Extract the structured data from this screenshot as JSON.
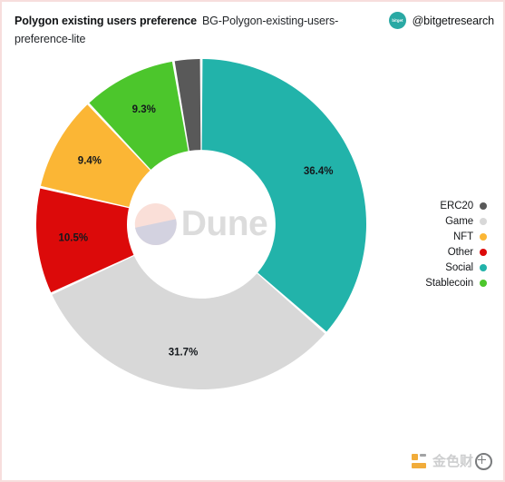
{
  "header": {
    "title_strong": "Polygon existing users preference",
    "title_sub": "BG-Polygon-existing-users-preference-lite",
    "avatar_text": "bitget",
    "handle": "@bitgetresearch"
  },
  "watermark": {
    "center_brand": "Dune",
    "corner_brand": "金色财",
    "corner_icon": "globe-icon"
  },
  "legend": {
    "items": [
      {
        "label": "ERC20",
        "color": "#595959"
      },
      {
        "label": "Game",
        "color": "#d8d8d8"
      },
      {
        "label": "NFT",
        "color": "#fbb635"
      },
      {
        "label": "Other",
        "color": "#dc0a0a"
      },
      {
        "label": "Social",
        "color": "#22b3aa"
      },
      {
        "label": "Stablecoin",
        "color": "#4cc62c"
      }
    ]
  },
  "chart_data": {
    "type": "pie",
    "variant": "donut",
    "title": "Polygon existing users preference",
    "xlabel": "",
    "ylabel": "",
    "legend_position": "right",
    "grid": false,
    "start_angle_deg": 0,
    "direction": "clockwise",
    "inner_radius_ratio": 0.45,
    "categories": [
      "Social",
      "Game",
      "Other",
      "NFT",
      "Stablecoin",
      "ERC20"
    ],
    "values": [
      36.4,
      31.7,
      10.5,
      9.4,
      9.3,
      2.7
    ],
    "unit": "%",
    "colors": [
      "#22b3aa",
      "#d8d8d8",
      "#dc0a0a",
      "#fbb635",
      "#4cc62c",
      "#595959"
    ],
    "slices": [
      {
        "name": "Social",
        "value": 36.4,
        "label": "36.4%",
        "color": "#22b3aa",
        "label_shown": true
      },
      {
        "name": "Game",
        "value": 31.7,
        "label": "31.7%",
        "color": "#d8d8d8",
        "label_shown": true
      },
      {
        "name": "Other",
        "value": 10.5,
        "label": "10.5%",
        "color": "#dc0a0a",
        "label_shown": true
      },
      {
        "name": "NFT",
        "value": 9.4,
        "label": "9.4%",
        "color": "#fbb635",
        "label_shown": true
      },
      {
        "name": "Stablecoin",
        "value": 9.3,
        "label": "9.3%",
        "color": "#4cc62c",
        "label_shown": true
      },
      {
        "name": "ERC20",
        "value": 2.7,
        "label": "",
        "color": "#595959",
        "label_shown": false
      }
    ]
  }
}
